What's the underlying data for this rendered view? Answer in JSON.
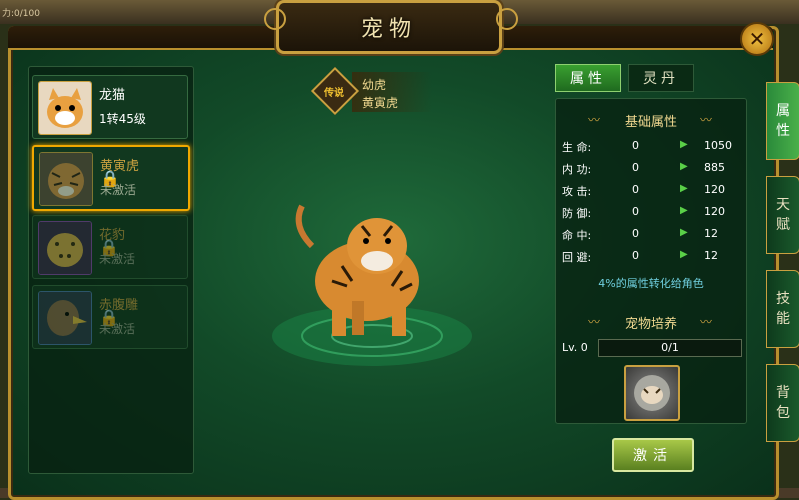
{
  "window": {
    "title": "宠物"
  },
  "background": {
    "top_left_text": "力:0/100"
  },
  "pets": [
    {
      "name": "龙猫",
      "level": "1转45级",
      "locked": false,
      "selected": false
    },
    {
      "name": "黄寅虎",
      "level": "未激活",
      "locked": true,
      "selected": true
    },
    {
      "name": "花豹",
      "level": "未激活",
      "locked": true,
      "selected": false
    },
    {
      "name": "赤腹雕",
      "level": "未激活",
      "locked": true,
      "selected": false
    }
  ],
  "pet_display": {
    "tier": "传说",
    "stage_name": "幼虎",
    "pet_name": "黄寅虎"
  },
  "tabs": [
    {
      "label": "属性"
    },
    {
      "label": "灵丹"
    }
  ],
  "base_attributes": {
    "title": "基础属性",
    "rows": [
      {
        "label": "生  命:",
        "current": "0",
        "next": "1050"
      },
      {
        "label": "内  功:",
        "current": "0",
        "next": "885"
      },
      {
        "label": "攻  击:",
        "current": "0",
        "next": "120"
      },
      {
        "label": "防  御:",
        "current": "0",
        "next": "120"
      },
      {
        "label": "命  中:",
        "current": "0",
        "next": "12"
      },
      {
        "label": "回  避:",
        "current": "0",
        "next": "12"
      }
    ],
    "convert_text": "4%的属性转化给角色"
  },
  "cultivation": {
    "title": "宠物培养",
    "level_label": "Lv. 0",
    "progress_text": "0/1",
    "progress_fraction": 0
  },
  "activate_button": {
    "label": "激活"
  },
  "side_tabs": [
    {
      "label": "属\n性"
    },
    {
      "label": "天\n赋"
    },
    {
      "label": "技\n能"
    },
    {
      "label": "背\n包"
    }
  ],
  "colors": {
    "accent_gold": "#c9a040",
    "active_green": "#3aa030",
    "highlight_orange": "#f0a800"
  }
}
